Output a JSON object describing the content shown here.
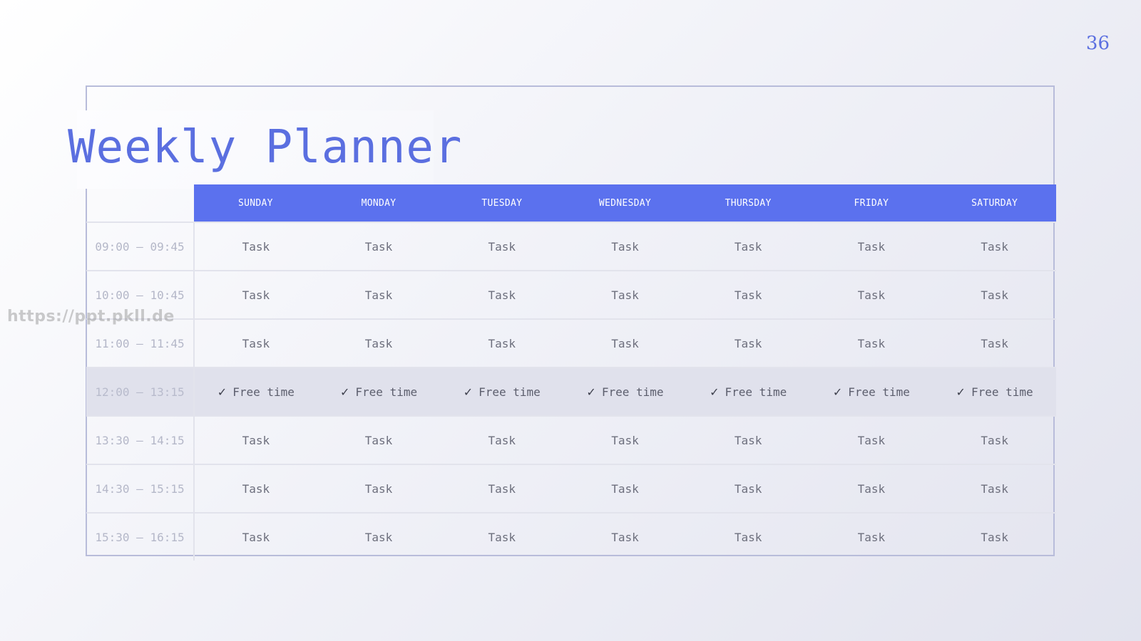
{
  "page_number": "36",
  "title": "Weekly Planner",
  "watermark": "https://ppt.pkll.de",
  "days": [
    "SUNDAY",
    "MONDAY",
    "TUESDAY",
    "WEDNESDAY",
    "THURSDAY",
    "FRIDAY",
    "SATURDAY"
  ],
  "rows": [
    {
      "time": "09:00 – 09:45",
      "type": "task",
      "cells": [
        "Task",
        "Task",
        "Task",
        "Task",
        "Task",
        "Task",
        "Task"
      ]
    },
    {
      "time": "10:00 – 10:45",
      "type": "task",
      "cells": [
        "Task",
        "Task",
        "Task",
        "Task",
        "Task",
        "Task",
        "Task"
      ]
    },
    {
      "time": "11:00 – 11:45",
      "type": "task",
      "cells": [
        "Task",
        "Task",
        "Task",
        "Task",
        "Task",
        "Task",
        "Task"
      ]
    },
    {
      "time": "12:00 – 13:15",
      "type": "free",
      "cells": [
        "Free time",
        "Free time",
        "Free time",
        "Free time",
        "Free time",
        "Free time",
        "Free time"
      ]
    },
    {
      "time": "13:30 – 14:15",
      "type": "task",
      "cells": [
        "Task",
        "Task",
        "Task",
        "Task",
        "Task",
        "Task",
        "Task"
      ]
    },
    {
      "time": "14:30 – 15:15",
      "type": "task",
      "cells": [
        "Task",
        "Task",
        "Task",
        "Task",
        "Task",
        "Task",
        "Task"
      ]
    },
    {
      "time": "15:30 – 16:15",
      "type": "task",
      "cells": [
        "Task",
        "Task",
        "Task",
        "Task",
        "Task",
        "Task",
        "Task"
      ]
    }
  ],
  "free_marker": "✓",
  "colors": {
    "accent": "#5b6fe0",
    "header_bg": "#5b71ee",
    "free_row_bg": "#e0e1ec",
    "frame": "#b8bcda"
  }
}
